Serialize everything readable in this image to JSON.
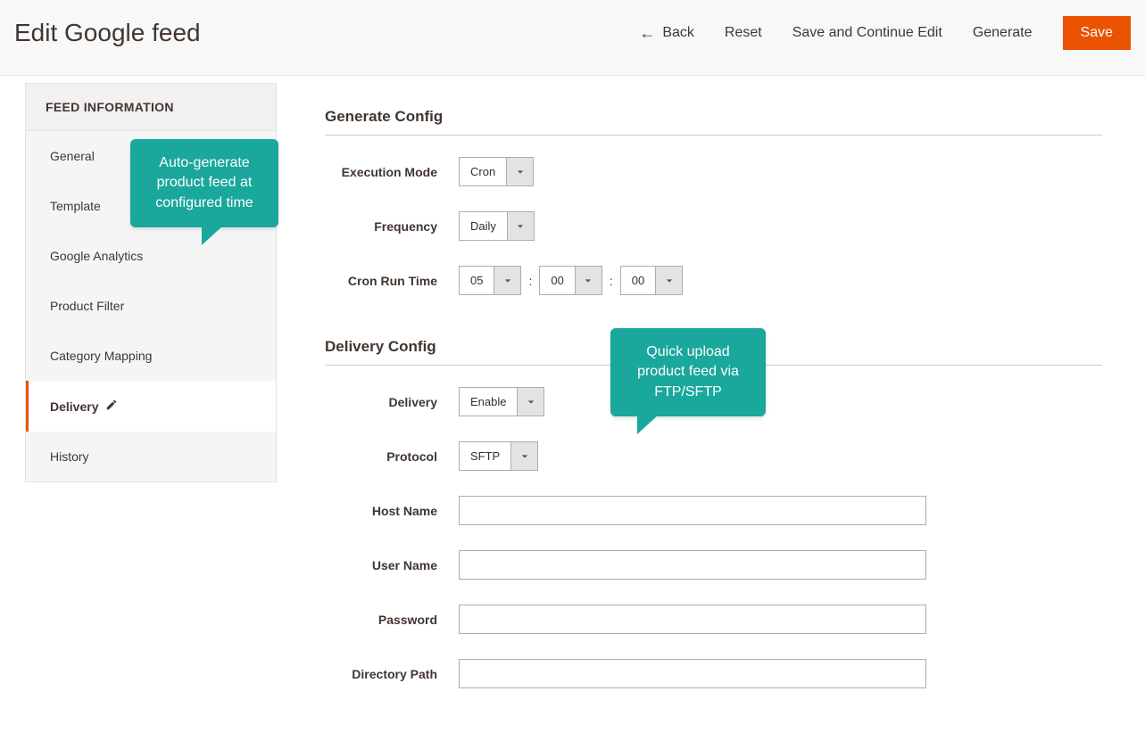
{
  "header": {
    "title": "Edit Google feed",
    "back": "Back",
    "reset": "Reset",
    "saveContinue": "Save and Continue Edit",
    "generate": "Generate",
    "save": "Save"
  },
  "sidebar": {
    "title": "FEED INFORMATION",
    "items": [
      {
        "label": "General"
      },
      {
        "label": "Template"
      },
      {
        "label": "Google Analytics"
      },
      {
        "label": "Product Filter"
      },
      {
        "label": "Category Mapping"
      },
      {
        "label": "Delivery"
      },
      {
        "label": "History"
      }
    ]
  },
  "generate": {
    "title": "Generate Config",
    "execMode": {
      "label": "Execution Mode",
      "value": "Cron"
    },
    "frequency": {
      "label": "Frequency",
      "value": "Daily"
    },
    "cronRunTime": {
      "label": "Cron Run Time",
      "hh": "05",
      "mm": "00",
      "ss": "00"
    }
  },
  "delivery": {
    "title": "Delivery Config",
    "delivery": {
      "label": "Delivery",
      "value": "Enable"
    },
    "protocol": {
      "label": "Protocol",
      "value": "SFTP"
    },
    "hostName": {
      "label": "Host Name",
      "value": ""
    },
    "userName": {
      "label": "User Name",
      "value": ""
    },
    "password": {
      "label": "Password",
      "value": ""
    },
    "dirPath": {
      "label": "Directory Path",
      "value": ""
    }
  },
  "callouts": {
    "c1": "Auto-generate product feed at configured time",
    "c2": "Quick upload product feed via FTP/SFTP"
  }
}
